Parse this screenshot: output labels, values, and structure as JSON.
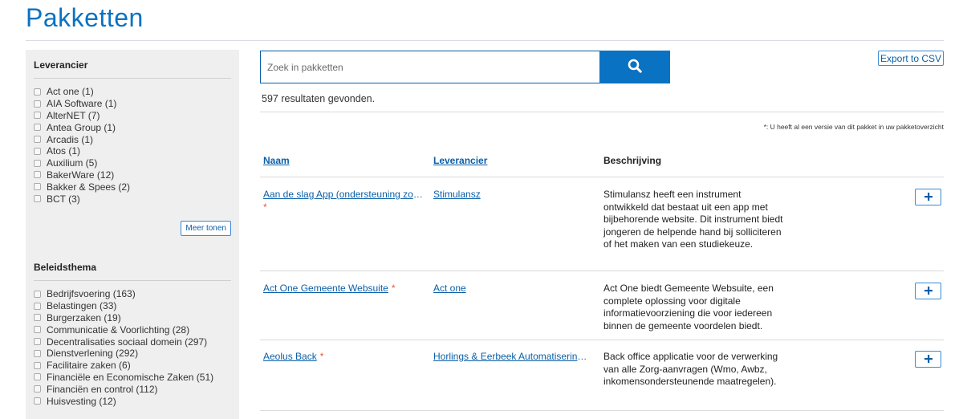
{
  "page": {
    "title": "Pakketten"
  },
  "sidebar": {
    "facets": [
      {
        "title": "Leverancier",
        "items": [
          "Act one (1)",
          "AIA Software (1)",
          "AlterNET (7)",
          "Antea Group (1)",
          "Arcadis (1)",
          "Atos (1)",
          "Auxilium (5)",
          "BakerWare (12)",
          "Bakker & Spees (2)",
          "BCT (3)"
        ],
        "more_label": "Meer tonen"
      },
      {
        "title": "Beleidsthema",
        "items": [
          "Bedrijfsvoering (163)",
          "Belastingen (33)",
          "Burgerzaken (19)",
          "Communicatie & Voorlichting (28)",
          "Decentralisaties sociaal domein (297)",
          "Dienstverlening (292)",
          "Facilitaire zaken (6)",
          "Financiële en Economische Zaken (51)",
          "Financiën en control (112)",
          "Huisvesting (12)"
        ]
      }
    ]
  },
  "search": {
    "placeholder": "Zoek in pakketten",
    "value": ""
  },
  "toolbar": {
    "csv_label": "Export to CSV"
  },
  "results": {
    "count_text": "597 resultaten gevonden.",
    "note": "*: U heeft al een versie van dit pakket in uw pakketoverzicht",
    "headers": {
      "name": "Naam",
      "vendor": "Leverancier",
      "description": "Beschrijving"
    },
    "rows": [
      {
        "name": "Aan de slag App (ondersteuning zoeken naar werk en studie)",
        "star": "*",
        "vendor": "Stimulansz",
        "description": "Stimulansz heeft een instrument ontwikkeld dat bestaat uit een app met bijbehorende website. Dit instrument biedt jongeren de helpende hand bij solliciteren of het maken van een studiekeuze."
      },
      {
        "name": "Act One Gemeente Websuite",
        "star": "*",
        "vendor": "Act one",
        "description": "Act One biedt Gemeente Websuite, een complete oplossing voor digitale informatievoorziening die voor iedereen binnen de gemeente voordelen biedt."
      },
      {
        "name": "Aeolus Back",
        "star": "*",
        "vendor": "Horlings & Eerbeek Automatisering B.V.",
        "description": "Back office applicatie voor de verwerking van alle Zorg-aanvragen (Wmo, Awbz, inkomensondersteunende maatregelen)."
      }
    ]
  },
  "icons": {
    "search": "search-icon",
    "add": "plus-icon",
    "checkbox": "checkbox"
  },
  "colors": {
    "brand": "#0a72c2",
    "link": "#0a5fa8",
    "star": "#e05a3a",
    "sidebar_bg": "#efefef"
  }
}
